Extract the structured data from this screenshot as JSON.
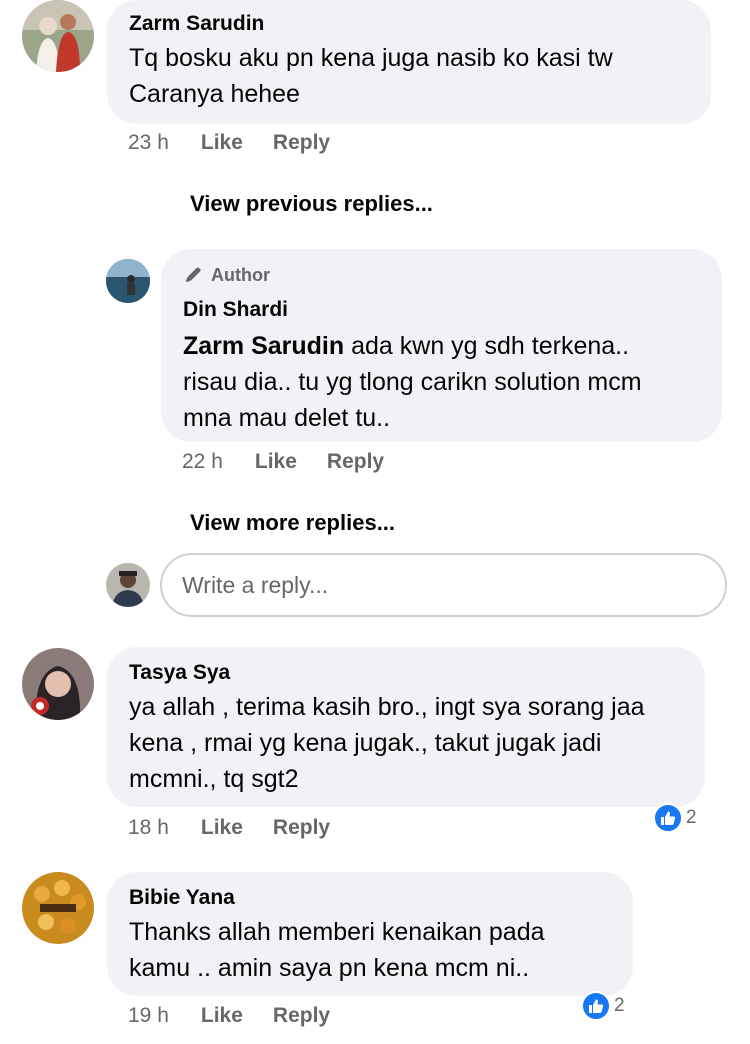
{
  "comments": [
    {
      "name": "Zarm Sarudin",
      "text": "Tq bosku aku pn kena juga nasib ko kasi tw Caranya hehee",
      "time": "23 h",
      "like": "Like",
      "reply": "Reply"
    },
    {
      "author_badge": "Author",
      "name": "Din Shardi",
      "mention": "Zarm Sarudin",
      "text": " ada kwn yg sdh terkena.. risau dia.. tu yg tlong carikn solution mcm mna mau delet tu..",
      "time": "22 h",
      "like": "Like",
      "reply": "Reply"
    },
    {
      "name": "Tasya Sya",
      "text": "ya allah , terima kasih bro., ingt sya sorang jaa kena , rmai yg kena jugak., takut jugak jadi mcmni., tq sgt2",
      "time": "18 h",
      "like": "Like",
      "reply": "Reply",
      "reactions": "2"
    },
    {
      "name": "Bibie Yana",
      "text": "Thanks allah memberi kenaikan pada kamu .. amin saya pn kena mcm ni..",
      "time": "19 h",
      "like": "Like",
      "reply": "Reply",
      "reactions": "2"
    }
  ],
  "links": {
    "view_previous": "View previous replies...",
    "view_more": "View more replies..."
  },
  "reply_box": {
    "placeholder": "Write a reply..."
  },
  "colors": {
    "bubble": "#f0f2f5",
    "meta": "#65676b",
    "like_blue": "#1877f2"
  },
  "icons": [
    "pencil-icon",
    "like-reaction-icon"
  ]
}
